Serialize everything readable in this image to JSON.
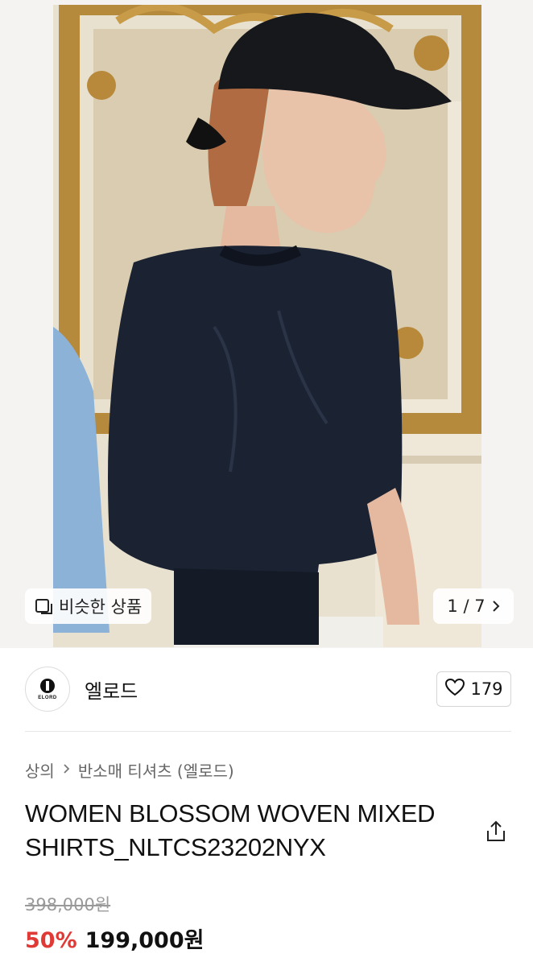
{
  "gallery": {
    "similar_label": "비슷한 상품",
    "counter": "1 / 7"
  },
  "brand": {
    "logo_text": "ELORD",
    "name": "엘로드",
    "like_count": "179"
  },
  "breadcrumb": {
    "items": [
      "상의",
      "반소매 티셔츠 (엘로드)"
    ]
  },
  "product": {
    "title": "WOMEN BLOSSOM WOVEN MIXED SHIRTS_NLTCS23202NYX",
    "original_price": "398,000원",
    "discount": "50%",
    "sale_price": "199,000원"
  },
  "colors": {
    "discount": "#e03a36",
    "shirt": "#1b2333",
    "frame_gold": "#b58a3c"
  },
  "icons": {
    "similar": "similar-items-icon",
    "chevron": "chevron-right-icon",
    "heart": "heart-icon",
    "share": "share-icon"
  }
}
